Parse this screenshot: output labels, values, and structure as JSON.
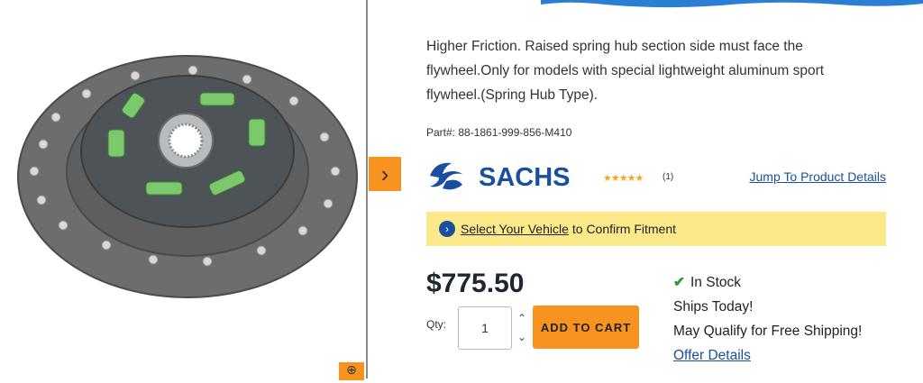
{
  "product": {
    "description": "Higher Friction. Raised spring hub section side must face the flywheel.Only for models with special lightweight aluminum sport flywheel.(Spring Hub Type).",
    "part_label": "Part#: 88-1861-999-856-M410",
    "brand": "SACHS",
    "rating_stars": "★★★★★",
    "review_count": "(1)",
    "jump_link": "Jump To Product Details",
    "price": "$775.50"
  },
  "vehicle": {
    "link": "Select Your Vehicle",
    "rest": "to Confirm Fitment"
  },
  "purchase": {
    "qty_label": "Qty:",
    "qty_value": "1",
    "add_to_cart": "ADD TO CART"
  },
  "availability": {
    "in_stock": "In Stock",
    "ships": "Ships Today!",
    "shipping": "May Qualify for Free Shipping!",
    "offer_link": "Offer Details"
  },
  "colors": {
    "accent_orange": "#f7931e",
    "link_blue": "#1a4fa0",
    "banner_yellow": "#fbe98a",
    "stock_green": "#2e9a36"
  },
  "icons": {
    "next": "chevron-right-icon",
    "zoom": "zoom-icon",
    "vehicle": "chevron-circle-icon",
    "stock": "check-icon"
  }
}
